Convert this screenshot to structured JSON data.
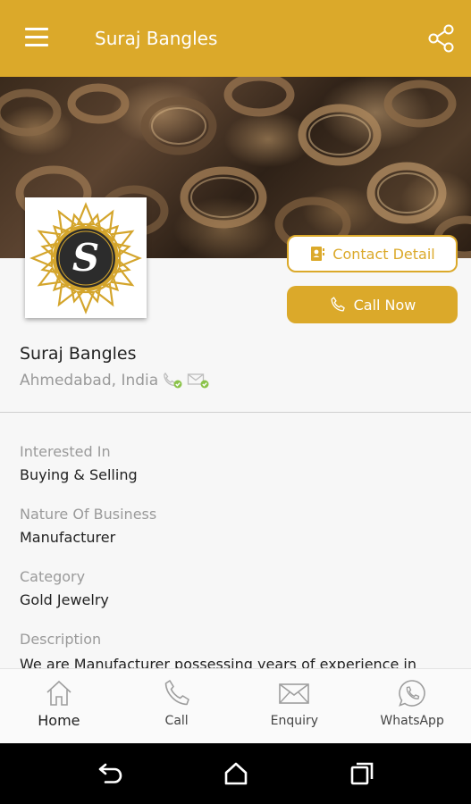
{
  "appbar": {
    "title": "Suraj Bangles",
    "menu_icon": "hamburger-menu-icon",
    "share_icon": "share-icon",
    "color": "#dba92a"
  },
  "hero": {
    "description": "banner image"
  },
  "logo": {
    "letter": "S"
  },
  "actions": {
    "contact_label": "Contact Detail",
    "call_label": "Call Now"
  },
  "business": {
    "name": "Suraj Bangles",
    "location": "Ahmedabad, India"
  },
  "details": [
    {
      "label": "Interested In",
      "value": "Buying & Selling"
    },
    {
      "label": "Nature Of Business",
      "value": "Manufacturer"
    },
    {
      "label": "Category",
      "value": "Gold Jewelry"
    },
    {
      "label": "Description",
      "value": "We are Manufacturer possessing years of experience in"
    }
  ],
  "bottom_nav": [
    {
      "label": "Home",
      "icon": "home-icon"
    },
    {
      "label": "Call",
      "icon": "phone-icon"
    },
    {
      "label": "Enquiry",
      "icon": "mail-icon"
    },
    {
      "label": "WhatsApp",
      "icon": "whatsapp-icon"
    }
  ],
  "system_nav": [
    "back-icon",
    "home-circle-icon",
    "recents-icon"
  ]
}
